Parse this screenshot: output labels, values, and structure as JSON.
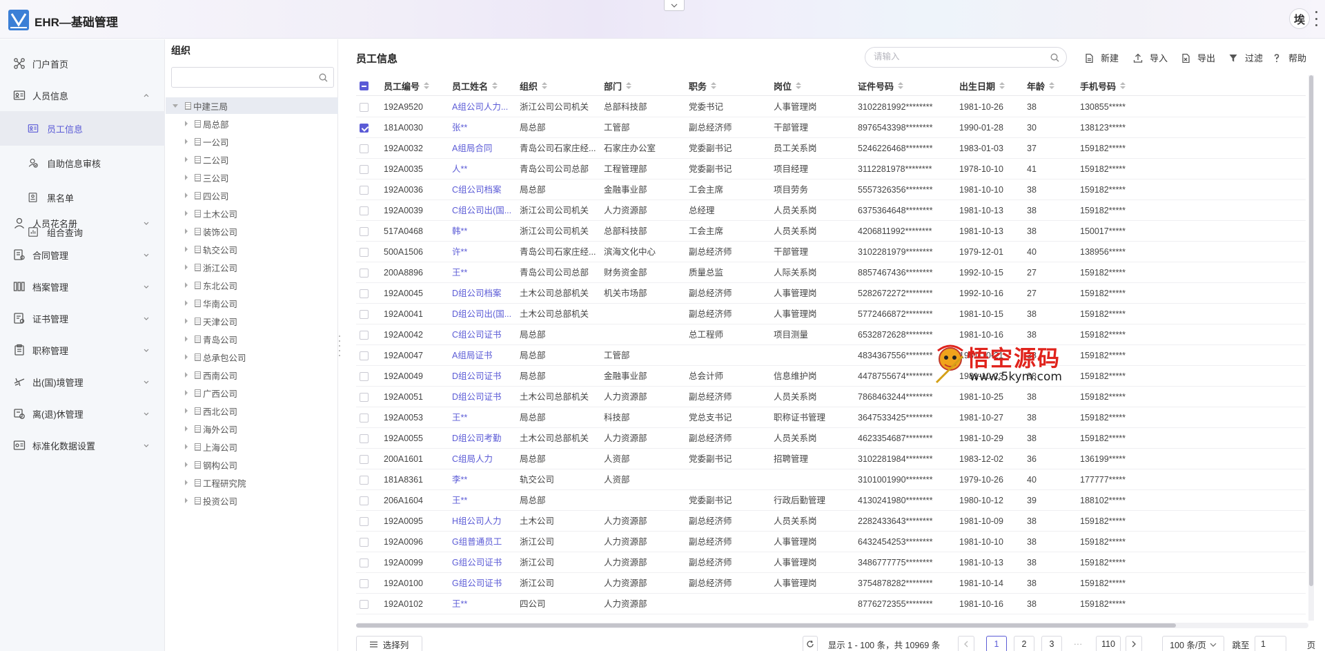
{
  "app": {
    "title": "EHR—基础管理",
    "avatar_text": "埃",
    "brand_color": "#5b5bd6"
  },
  "nav": {
    "items": [
      {
        "label": "门户首页",
        "icon": "connections-icon"
      },
      {
        "label": "人员信息",
        "icon": "id-card-icon",
        "expanded": true
      },
      {
        "label": "人员花名册",
        "icon": "person-icon"
      },
      {
        "label": "合同管理",
        "icon": "contract-icon"
      },
      {
        "label": "档案管理",
        "icon": "archive-icon"
      },
      {
        "label": "证书管理",
        "icon": "certificate-icon"
      },
      {
        "label": "职称管理",
        "icon": "clipboard-icon"
      },
      {
        "label": "出(国)境管理",
        "icon": "plane-icon"
      },
      {
        "label": "离(退)休管理",
        "icon": "retire-icon"
      },
      {
        "label": "标准化数据设置",
        "icon": "settings-card-icon"
      }
    ],
    "sub_items": [
      {
        "label": "员工信息",
        "icon": "id-card-icon",
        "active": true
      },
      {
        "label": "自助信息审核",
        "icon": "user-check-icon"
      },
      {
        "label": "黑名单",
        "icon": "blacklist-icon"
      },
      {
        "label": "组合查询",
        "icon": "chart-icon"
      }
    ]
  },
  "org": {
    "title": "组织",
    "search_placeholder": "",
    "root": "中建三局",
    "children": [
      "局总部",
      "一公司",
      "二公司",
      "三公司",
      "四公司",
      "土木公司",
      "装饰公司",
      "轨交公司",
      "浙江公司",
      "东北公司",
      "华南公司",
      "天津公司",
      "青岛公司",
      "总承包公司",
      "西南公司",
      "广西公司",
      "西北公司",
      "海外公司",
      "上海公司",
      "钢构公司",
      "工程研究院",
      "投资公司"
    ]
  },
  "main": {
    "title": "员工信息",
    "search_placeholder": "请输入",
    "tools": [
      {
        "label": "新建",
        "icon": "new-doc-icon"
      },
      {
        "label": "导入",
        "icon": "upload-icon"
      },
      {
        "label": "导出",
        "icon": "export-doc-icon"
      },
      {
        "label": "过滤",
        "icon": "filter-icon"
      },
      {
        "label": "帮助",
        "icon": "question-icon"
      }
    ]
  },
  "table": {
    "columns": [
      "员工编号",
      "员工姓名",
      "组织",
      "部门",
      "职务",
      "岗位",
      "证件号码",
      "出生日期",
      "年龄",
      "手机号码"
    ],
    "rows": [
      [
        "192A9520",
        "A组公司人力...",
        "浙江公司公司机关",
        "总部科技部",
        "党委书记",
        "人事管理岗",
        "3102281992********",
        "1981-10-26",
        "38",
        "130855*****"
      ],
      [
        "181A0030",
        "张**",
        "局总部",
        "工管部",
        "副总经济师",
        "干部管理",
        "8976543398********",
        "1990-01-28",
        "30",
        "138123*****"
      ],
      [
        "192A0032",
        "A组局合同",
        "青岛公司石家庄经...",
        "石家庄办公室",
        "党委副书记",
        "员工关系岗",
        "5246226468********",
        "1983-01-03",
        "37",
        "159182*****"
      ],
      [
        "192A0035",
        "人**",
        "青岛公司公司总部",
        "工程管理部",
        "党委副书记",
        "项目经理",
        "3112281978********",
        "1978-10-10",
        "41",
        "159182*****"
      ],
      [
        "192A0036",
        "C组公司档案",
        "局总部",
        "金融事业部",
        "工会主席",
        "项目劳务",
        "5557326356********",
        "1981-10-10",
        "38",
        "159182*****"
      ],
      [
        "192A0039",
        "C组公司出(国...",
        "浙江公司公司机关",
        "人力资源部",
        "总经理",
        "人员关系岗",
        "6375364648********",
        "1981-10-13",
        "38",
        "159182*****"
      ],
      [
        "517A0468",
        "韩**",
        "浙江公司公司机关",
        "总部科技部",
        "工会主席",
        "人员关系岗",
        "4206811992********",
        "1981-10-13",
        "38",
        "150017*****"
      ],
      [
        "500A1506",
        "许**",
        "青岛公司石家庄经...",
        "滨海文化中心",
        "副总经济师",
        "干部管理",
        "3102281979********",
        "1979-12-01",
        "40",
        "138956*****"
      ],
      [
        "200A8896",
        "王**",
        "青岛公司公司总部",
        "财务资金部",
        "质量总监",
        "人际关系岗",
        "8857467436********",
        "1992-10-15",
        "27",
        "159182*****"
      ],
      [
        "192A0045",
        "D组公司档案",
        "土木公司总部机关",
        "机关市场部",
        "副总经济师",
        "人事管理岗",
        "5282672272********",
        "1992-10-16",
        "27",
        "159182*****"
      ],
      [
        "192A0041",
        "D组公司出(国...",
        "土木公司总部机关",
        "",
        "副总经济师",
        "人事管理岗",
        "5772466872********",
        "1981-10-15",
        "38",
        "159182*****"
      ],
      [
        "192A0042",
        "C组公司证书",
        "局总部",
        "",
        "总工程师",
        "项目测量",
        "6532872628********",
        "1981-10-16",
        "38",
        "159182*****"
      ],
      [
        "192A0047",
        "A组局证书",
        "局总部",
        "工管部",
        "",
        "",
        "4834367556********",
        "1981-10-21",
        "38",
        "159182*****"
      ],
      [
        "192A0049",
        "D组公司证书",
        "局总部",
        "金融事业部",
        "总会计师",
        "信息维护岗",
        "4478755674********",
        "1981-10-23",
        "38",
        "159182*****"
      ],
      [
        "192A0051",
        "D组公司证书",
        "土木公司总部机关",
        "人力资源部",
        "副总经济师",
        "人员关系岗",
        "7868463244********",
        "1981-10-25",
        "38",
        "159182*****"
      ],
      [
        "192A0053",
        "王**",
        "局总部",
        "科技部",
        "党总支书记",
        "职称证书管理",
        "3647533425********",
        "1981-10-27",
        "38",
        "159182*****"
      ],
      [
        "192A0055",
        "D组公司考勤",
        "土木公司总部机关",
        "人力资源部",
        "副总经济师",
        "人员关系岗",
        "4623354687********",
        "1981-10-29",
        "38",
        "159182*****"
      ],
      [
        "200A1601",
        "C组局人力",
        "局总部",
        "人资部",
        "党委副书记",
        "招聘管理",
        "3102281984********",
        "1983-12-02",
        "36",
        "136199*****"
      ],
      [
        "181A8361",
        "李**",
        "轨交公司",
        "人资部",
        "",
        "",
        "3101001990********",
        "1979-10-26",
        "40",
        "177777*****"
      ],
      [
        "206A1604",
        "王**",
        "局总部",
        "",
        "党委副书记",
        "行政后勤管理",
        "4130241980********",
        "1980-10-12",
        "39",
        "188102*****"
      ],
      [
        "192A0095",
        "H组公司人力",
        "土木公司",
        "人力资源部",
        "副总经济师",
        "人员关系岗",
        "2282433643********",
        "1981-10-09",
        "38",
        "159182*****"
      ],
      [
        "192A0096",
        "G组普通员工",
        "浙江公司",
        "人力资源部",
        "副总经济师",
        "人事管理岗",
        "6432454253********",
        "1981-10-10",
        "38",
        "159182*****"
      ],
      [
        "192A0099",
        "G组公司证书",
        "浙江公司",
        "人力资源部",
        "副总经济师",
        "人事管理岗",
        "3486777775********",
        "1981-10-13",
        "38",
        "159182*****"
      ],
      [
        "192A0100",
        "G组公司证书",
        "浙江公司",
        "人力资源部",
        "副总经济师",
        "人事管理岗",
        "3754878282********",
        "1981-10-14",
        "38",
        "159182*****"
      ],
      [
        "192A0102",
        "王**",
        "四公司",
        "人力资源部",
        "",
        "",
        "8776272355********",
        "1981-10-16",
        "38",
        "159182*****"
      ]
    ],
    "checked_row": 1
  },
  "footer": {
    "select_columns": "选择列",
    "summary": "显示 1 - 100 条，共 10969 条",
    "pages": [
      "1",
      "2",
      "3"
    ],
    "ellipsis": "···",
    "last_page": "110",
    "page_size": "100 条/页",
    "jump_label": "跳至",
    "jump_value": "1",
    "page_suffix": "页"
  },
  "watermark": {
    "title": "悟空源码",
    "url": "www.5kym.com"
  }
}
